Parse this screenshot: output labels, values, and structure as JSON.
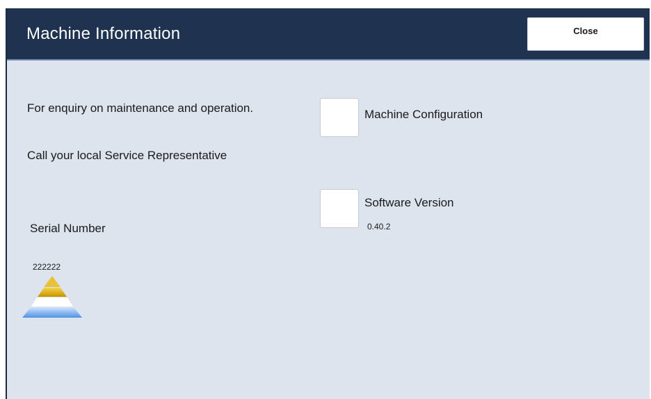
{
  "header": {
    "title": "Machine Information",
    "close_label": "Close"
  },
  "info": {
    "enquiry_text": "For enquiry on maintenance and operation.",
    "call_text": "Call your local Service Representative"
  },
  "serial": {
    "label": "Serial Number",
    "value": "222222"
  },
  "options": {
    "machine_configuration": "Machine Configuration",
    "software_version": "Software Version",
    "software_version_value": "0.40.2"
  },
  "icons": {
    "logo": "xerox-pyramid-icon"
  },
  "colors": {
    "titlebar": "#1f3350",
    "panel": "#dde4ee",
    "logo_gold": "#d6a514",
    "logo_blue": "#5f9fe8"
  }
}
